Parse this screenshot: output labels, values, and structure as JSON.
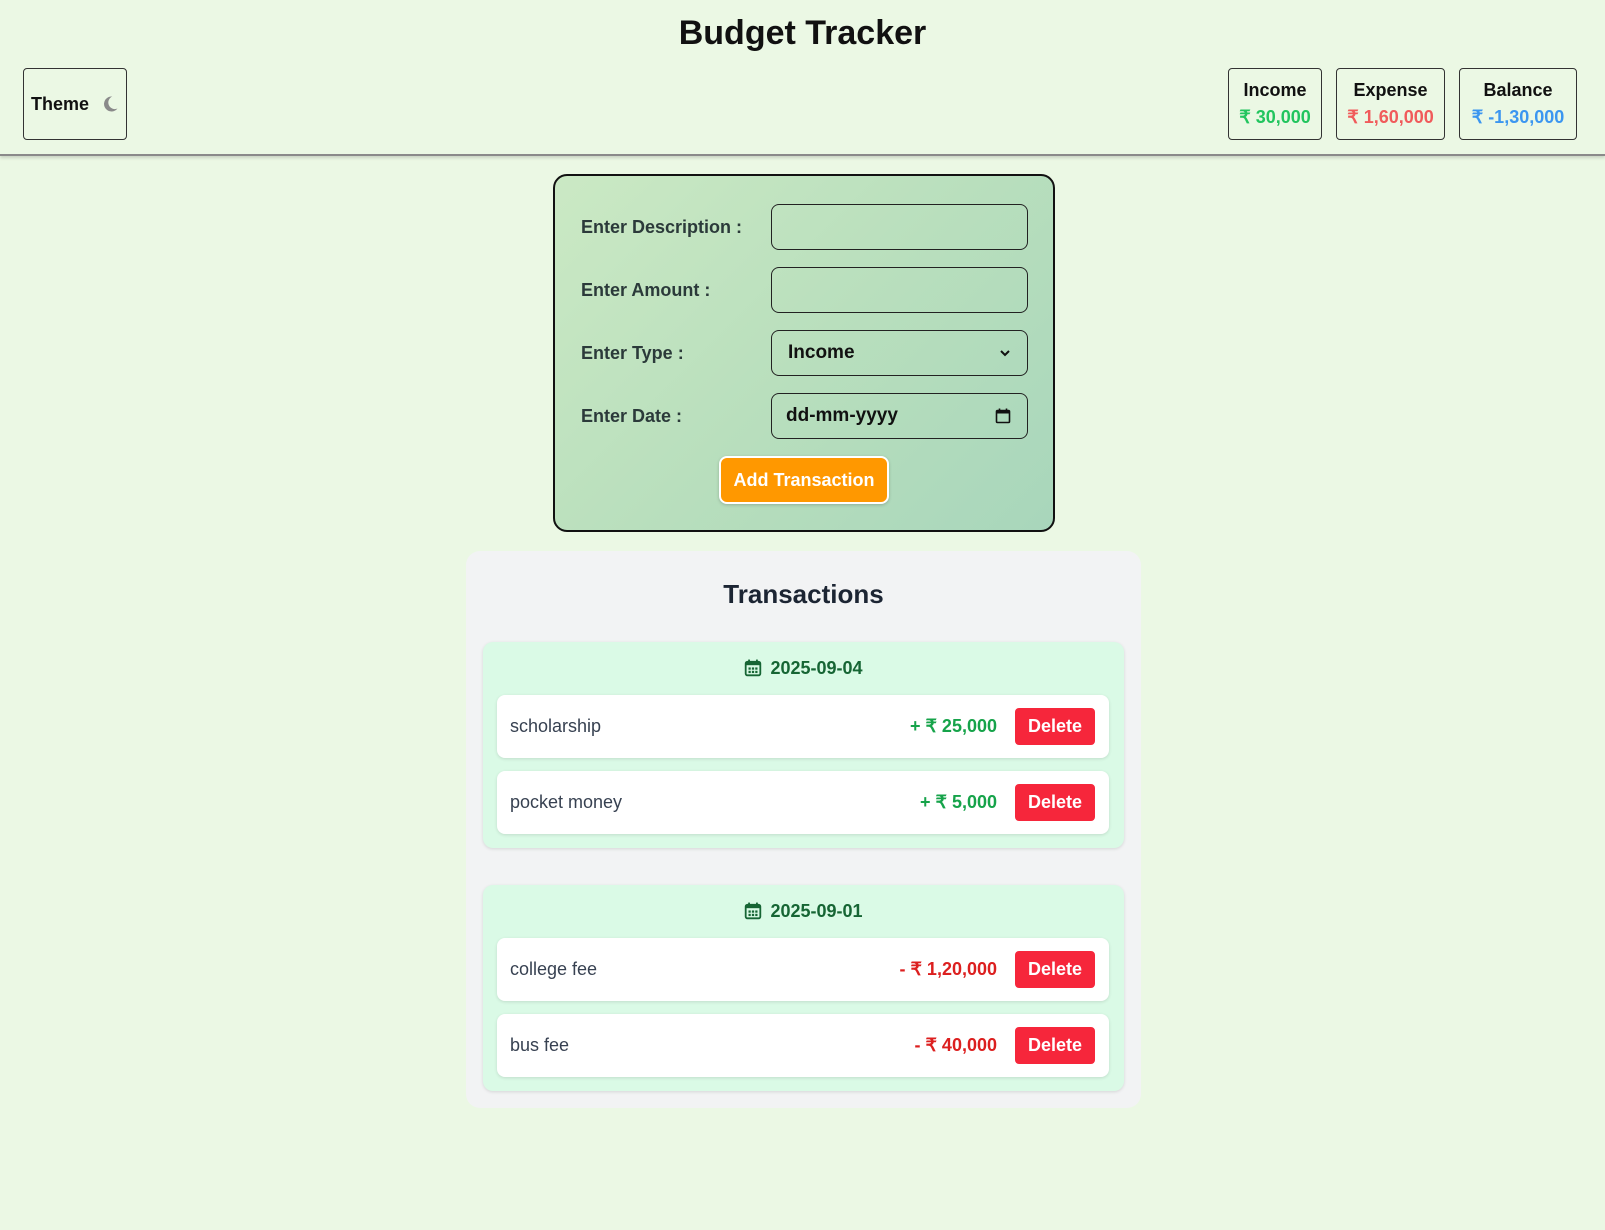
{
  "app": {
    "title": "Budget Tracker"
  },
  "theme": {
    "label": "Theme",
    "icon": "moon-icon"
  },
  "summary": {
    "income": {
      "label": "Income",
      "value": "₹ 30,000",
      "color": "#22c55e"
    },
    "expense": {
      "label": "Expense",
      "value": "₹ 1,60,000",
      "color": "#f05b5b"
    },
    "balance": {
      "label": "Balance",
      "value": "₹ -1,30,000",
      "color": "#3b96f0"
    }
  },
  "form": {
    "description_label": "Enter Description :",
    "description_value": "",
    "amount_label": "Enter Amount :",
    "amount_value": "",
    "type_label": "Enter Type :",
    "type_value": "Income",
    "date_label": "Enter Date :",
    "date_placeholder": "dd-mm-yyyy",
    "submit_label": "Add Transaction",
    "submit_color": "#ff9800"
  },
  "transactions": {
    "title": "Transactions",
    "groups": [
      {
        "date": "2025-09-04",
        "items": [
          {
            "description": "scholarship",
            "amount": "+ ₹ 25,000",
            "type": "income",
            "delete_label": "Delete"
          },
          {
            "description": "pocket money",
            "amount": "+ ₹ 5,000",
            "type": "income",
            "delete_label": "Delete"
          }
        ]
      },
      {
        "date": "2025-09-01",
        "items": [
          {
            "description": "college fee",
            "amount": "- ₹ 1,20,000",
            "type": "expense",
            "delete_label": "Delete"
          },
          {
            "description": "bus fee",
            "amount": "- ₹ 40,000",
            "type": "expense",
            "delete_label": "Delete"
          }
        ]
      }
    ]
  }
}
